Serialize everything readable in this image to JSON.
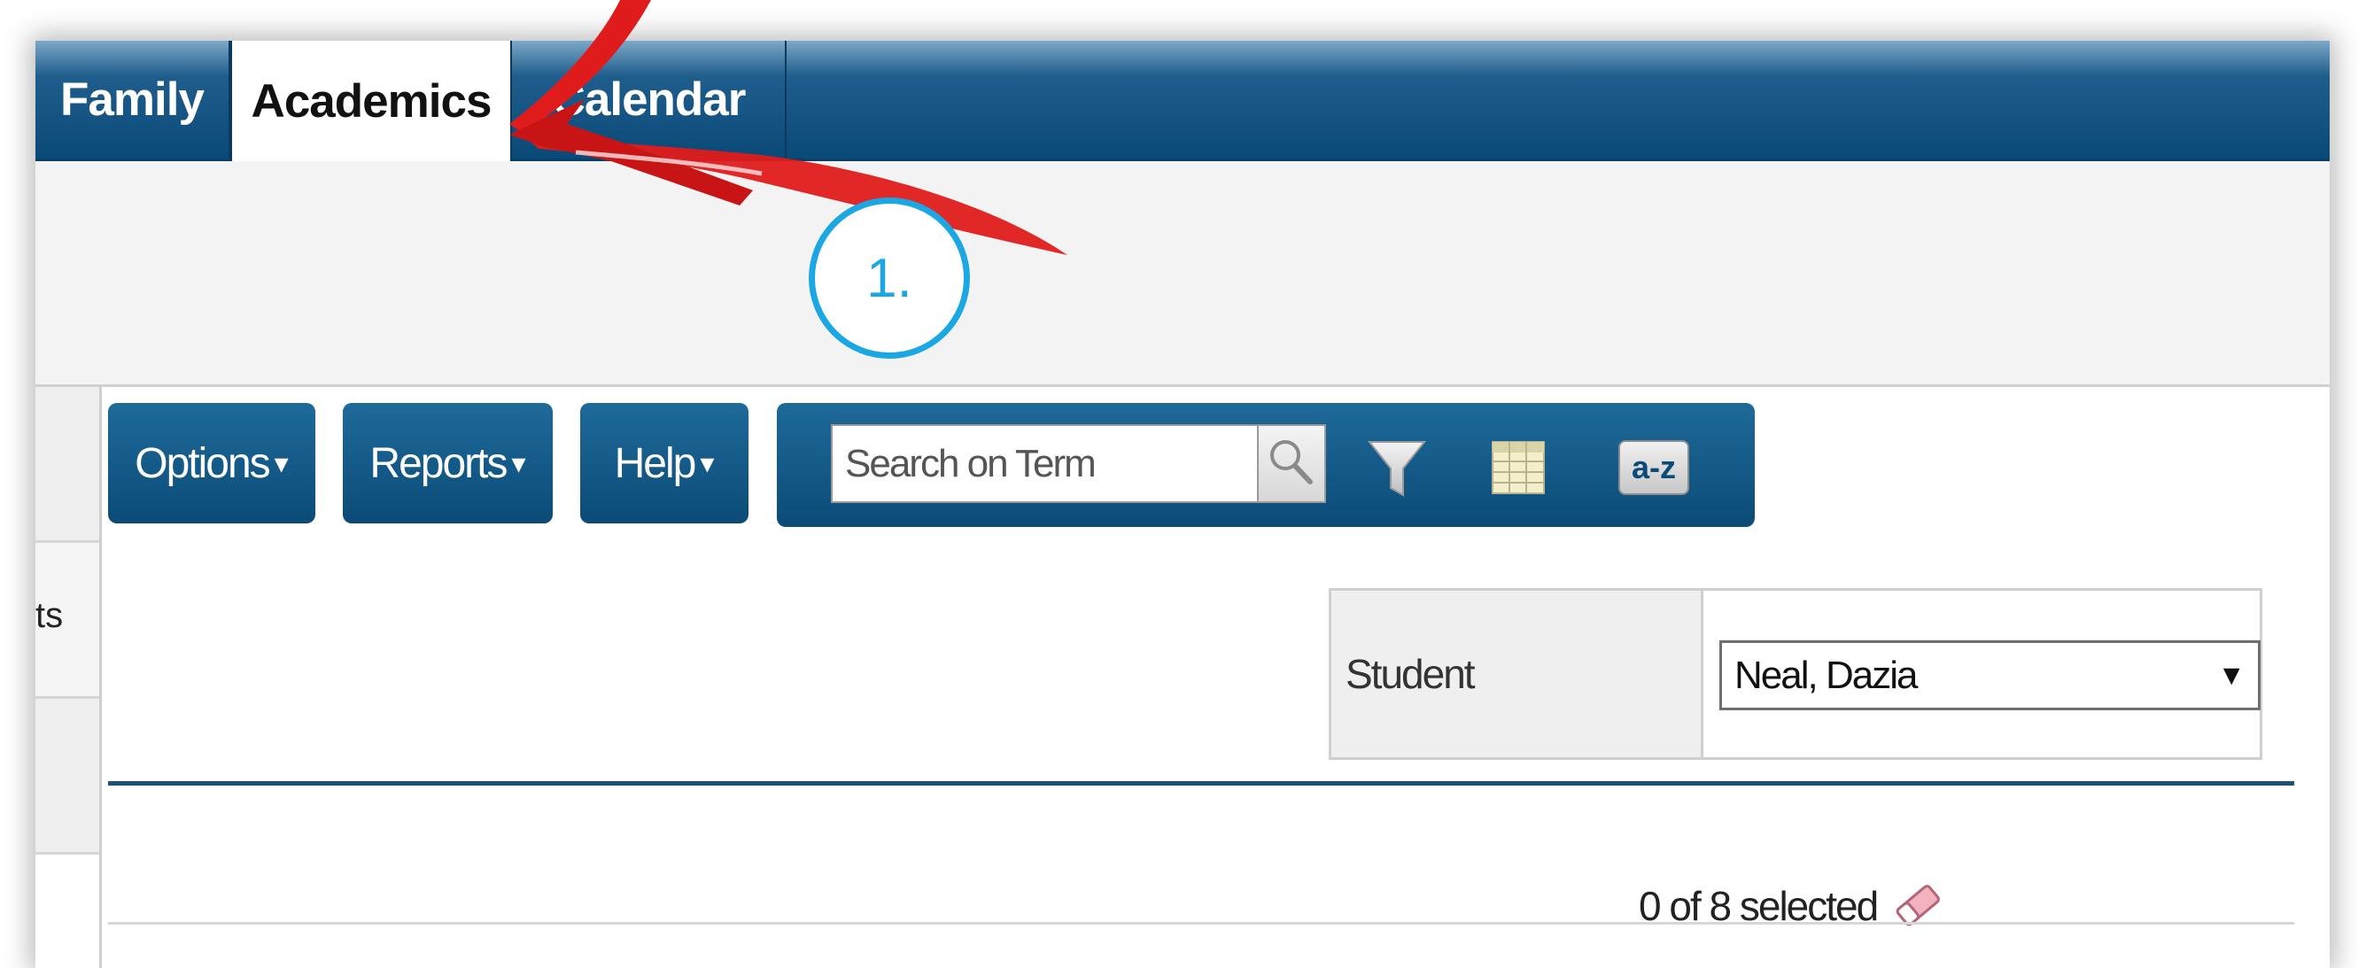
{
  "tabs": [
    {
      "label": "Family",
      "active": false
    },
    {
      "label": "Academics",
      "active": true
    },
    {
      "label": "Calendar",
      "active": false
    }
  ],
  "sidebar": {
    "partial_label": "ts"
  },
  "toolbar": {
    "options_label": "Options",
    "reports_label": "Reports",
    "help_label": "Help",
    "caret": "▾",
    "search_placeholder": "Search on Term",
    "az_label": "a-z",
    "icons": [
      "search-icon",
      "filter-icon",
      "grid-icon",
      "sort-az-icon"
    ]
  },
  "student": {
    "label": "Student",
    "selected": "Neal, Dazia",
    "arrow": "▼"
  },
  "selection": {
    "count_text": "0 of 8 selected"
  },
  "annotation": {
    "step_label": "1."
  },
  "colors": {
    "nav_blue": "#0b4b78",
    "annotation_red": "#e01b1b",
    "step_circle": "#1aa7e4"
  }
}
